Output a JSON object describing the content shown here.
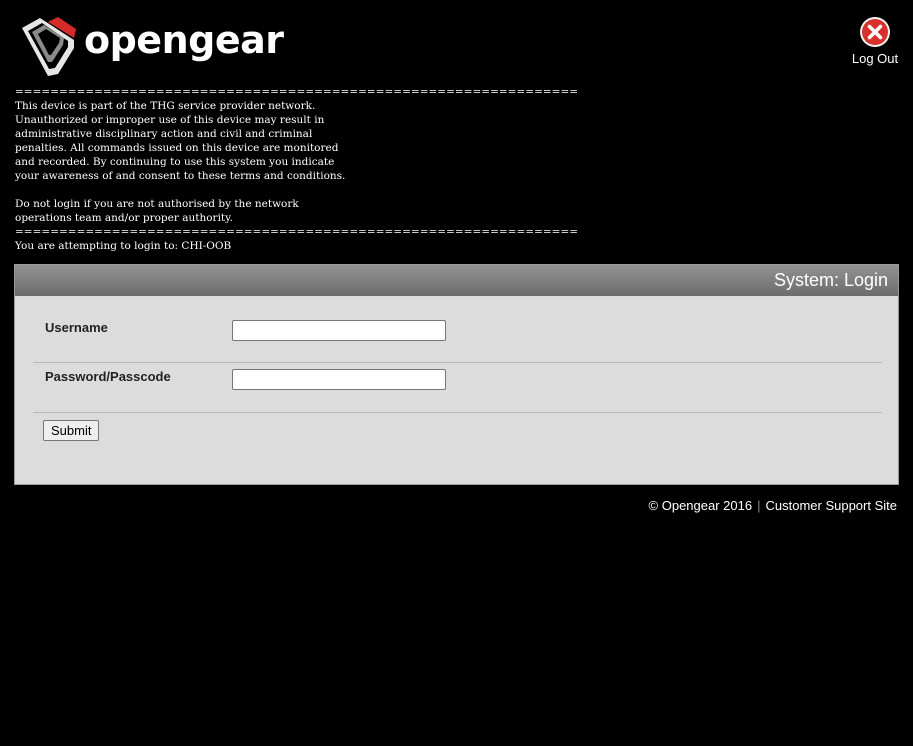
{
  "header": {
    "logo_text": "opengear",
    "logout_label": "Log Out"
  },
  "banner": {
    "text": "================================================================\nThis device is part of the THG service provider network.\nUnauthorized or improper use of this device may result in\nadministrative disciplinary action and civil and criminal\npenalties. All commands issued on this device are monitored\nand recorded. By continuing to use this system you indicate\nyour awareness of and consent to these terms and conditions.\n\nDo not login if you are not authorised by the network\noperations team and/or proper authority.\n================================================================\nYou are attempting to login to: CHI-OOB"
  },
  "login": {
    "title": "System: Login",
    "username_label": "Username",
    "username_value": "",
    "password_label": "Password/Passcode",
    "password_value": "",
    "submit_label": "Submit"
  },
  "footer": {
    "copyright": "© Opengear 2016",
    "separator": "|",
    "support_link": "Customer Support Site"
  },
  "colors": {
    "background": "#000000",
    "panel": "#dcdcdc",
    "panel_header": "#7f7f7f",
    "logo_red": "#d42a2a",
    "logout_red": "#d9302c"
  }
}
